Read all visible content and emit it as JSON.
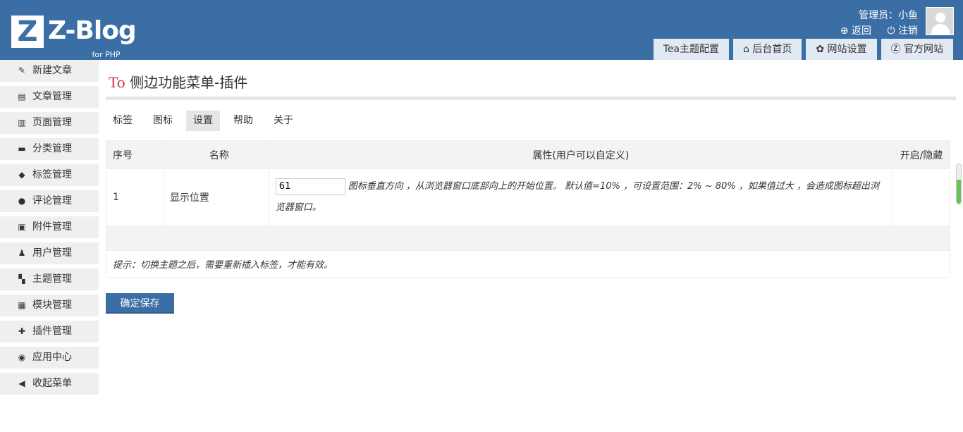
{
  "header": {
    "logo_letter": "Z",
    "logo_text": "Z-Blog",
    "logo_sub": "for PHP",
    "user_label": "管理员：小鱼",
    "back_label": "⊕ 返回",
    "logout_label": "⏻ 注销",
    "tabs": [
      {
        "label": "Tea主题配置"
      },
      {
        "label": "⌂ 后台首页"
      },
      {
        "label": "✿ 网站设置"
      },
      {
        "label": "Ⓩ 官方网站"
      }
    ]
  },
  "sidebar": {
    "items": [
      {
        "icon": "✎",
        "label": "新建文章"
      },
      {
        "icon": "▤",
        "label": "文章管理"
      },
      {
        "icon": "▥",
        "label": "页面管理"
      },
      {
        "icon": "▬",
        "label": "分类管理"
      },
      {
        "icon": "◆",
        "label": "标签管理"
      },
      {
        "icon": "●",
        "label": "评论管理"
      },
      {
        "icon": "▣",
        "label": "附件管理"
      },
      {
        "icon": "♟",
        "label": "用户管理"
      },
      {
        "icon": "▚",
        "label": "主题管理"
      },
      {
        "icon": "▦",
        "label": "模块管理"
      },
      {
        "icon": "✚",
        "label": "插件管理"
      },
      {
        "icon": "◉",
        "label": "应用中心"
      },
      {
        "icon": "◀",
        "label": "收起菜单"
      }
    ]
  },
  "main": {
    "title_prefix": "To",
    "title": " 侧边功能菜单-插件",
    "subtabs": [
      {
        "label": "标签"
      },
      {
        "label": "图标"
      },
      {
        "label": "设置"
      },
      {
        "label": "帮助"
      },
      {
        "label": "关于"
      }
    ],
    "table": {
      "headers": [
        "序号",
        "名称",
        "属性(用户可以自定义)",
        "开启/隐藏"
      ],
      "row": {
        "index": "1",
        "name": "显示位置",
        "input_value": "61",
        "description": "图标垂直方向 ，从浏览器窗口底部向上的开始位置。 默认值=10% ，可设置范围：2% ~ 80% ，如果值过大 ，会造成图标超出浏览器窗口。"
      },
      "tip": "提示：切换主题之后，需要重新插入标签，才能有效。"
    },
    "save_label": "确定保存"
  },
  "colors": {
    "header_bg": "#3a6ea5",
    "tab_bg": "#e1e9f3",
    "title_accent": "#cc3333",
    "scroll_indicator": "#6cbf5a"
  }
}
